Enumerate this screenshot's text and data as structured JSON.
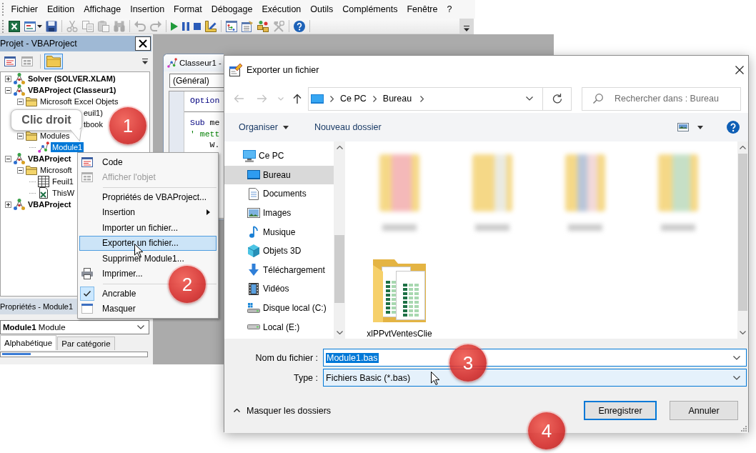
{
  "menu_bar": [
    "Fichier",
    "Edition",
    "Affichage",
    "Insertion",
    "Format",
    "Débogage",
    "Exécution",
    "Outils",
    "Compléments",
    "Fenêtre",
    "?"
  ],
  "toolbar": [
    {
      "kind": "button",
      "disabled": false
    },
    {
      "kind": "button",
      "disabled": false
    },
    {
      "kind": "button",
      "disabled": false
    },
    {
      "kind": "separator"
    },
    {
      "kind": "button",
      "disabled": true
    },
    {
      "kind": "button",
      "disabled": true
    },
    {
      "kind": "button",
      "disabled": true
    },
    {
      "kind": "button",
      "disabled": true
    },
    {
      "kind": "separator"
    },
    {
      "kind": "button",
      "disabled": true
    },
    {
      "kind": "button",
      "disabled": true
    },
    {
      "kind": "separator"
    },
    {
      "kind": "button",
      "disabled": false
    },
    {
      "kind": "button",
      "disabled": false
    },
    {
      "kind": "button",
      "disabled": false
    },
    {
      "kind": "button",
      "disabled": false
    },
    {
      "kind": "separator"
    },
    {
      "kind": "button",
      "disabled": false
    },
    {
      "kind": "button",
      "disabled": false
    },
    {
      "kind": "button",
      "disabled": false
    },
    {
      "kind": "button",
      "disabled": true
    },
    {
      "kind": "separator"
    },
    {
      "kind": "button",
      "disabled": false
    },
    {
      "kind": "separator"
    }
  ],
  "project_pane": {
    "title": "Projet - VBAProject",
    "toolbar": [
      {
        "disabled": false,
        "pressed": false
      },
      {
        "disabled": true,
        "pressed": false
      },
      {
        "disabled": false,
        "pressed": true
      }
    ],
    "tree": [
      {
        "kind": "project",
        "label": "Solver (SOLVER.XLAM)",
        "expanded": false,
        "selected": false
      },
      {
        "kind": "project",
        "label": "VBAProject (Classeur1)",
        "expanded": true,
        "selected": false,
        "children": [
          {
            "kind": "folder",
            "label": "Microsoft Excel Objets",
            "expanded": true,
            "selected": false,
            "children": [
              {
                "kind": "covered",
                "label": "euil1)",
                "selected": false
              },
              {
                "kind": "covered",
                "label": "tbook",
                "selected": false
              }
            ]
          },
          {
            "kind": "folder",
            "label": "Modules",
            "expanded": true,
            "selected": false,
            "children": [
              {
                "kind": "module",
                "label": "Module1",
                "selected": true
              }
            ]
          }
        ]
      },
      {
        "kind": "project",
        "label": "VBAProject",
        "expanded": true,
        "selected": false,
        "children": [
          {
            "kind": "folder",
            "label": "Microsoft",
            "expanded": true,
            "selected": false,
            "children": [
              {
                "kind": "sheet",
                "label": "Feuil1",
                "selected": false
              },
              {
                "kind": "workbook",
                "label": "ThisW",
                "selected": false
              }
            ]
          }
        ]
      },
      {
        "kind": "project",
        "label": "VBAProject",
        "expanded": false,
        "selected": false
      }
    ]
  },
  "properties_pane": {
    "title": "Propriétés - Module1",
    "object": "**Module1** Module",
    "tabs": [
      {
        "label": "Alphabétique",
        "selected": true
      },
      {
        "label": "Par catégorie",
        "selected": false
      }
    ]
  },
  "code_window": {
    "title": "Classeur1 -",
    "object": "(Général)",
    "lines": [
      {
        "kind": "code",
        "tokens": [
          {
            "kind": "keyword",
            "text": "Option"
          }
        ]
      },
      {
        "kind": "divider"
      },
      {
        "kind": "code",
        "tokens": [
          {
            "kind": "keyword",
            "text": "Sub"
          },
          {
            "kind": "plain",
            "text": " me"
          }
        ]
      },
      {
        "kind": "code",
        "tokens": [
          {
            "kind": "comment",
            "text": "' mett"
          }
        ]
      },
      {
        "kind": "code",
        "tokens": [
          {
            "kind": "plain",
            "text": "    W."
          }
        ]
      }
    ]
  },
  "context_menu": [
    {
      "kind": "item",
      "label": "Code",
      "disabled": false,
      "selected": false,
      "checked": false,
      "submenu": false
    },
    {
      "kind": "item",
      "label": "Afficher l'objet",
      "disabled": true,
      "selected": false,
      "checked": false,
      "submenu": false
    },
    {
      "kind": "separator"
    },
    {
      "kind": "item",
      "label": "Propriétés de VBAProject...",
      "disabled": false,
      "selected": false,
      "checked": false,
      "submenu": false
    },
    {
      "kind": "item",
      "label": "Insertion",
      "disabled": false,
      "selected": false,
      "checked": false,
      "submenu": true
    },
    {
      "kind": "item",
      "label": "Importer un fichier...",
      "disabled": false,
      "selected": false,
      "checked": false,
      "submenu": false
    },
    {
      "kind": "item",
      "label": "Exporter un fichier...",
      "disabled": false,
      "selected": true,
      "checked": false,
      "submenu": false
    },
    {
      "kind": "item",
      "label": "Supprimer Module1...",
      "disabled": false,
      "selected": false,
      "checked": false,
      "submenu": false
    },
    {
      "kind": "item",
      "label": "Imprimer...",
      "disabled": false,
      "selected": false,
      "checked": false,
      "submenu": false
    },
    {
      "kind": "separator"
    },
    {
      "kind": "item",
      "label": "Ancrable",
      "disabled": false,
      "selected": false,
      "checked": true,
      "submenu": false
    },
    {
      "kind": "item",
      "label": "Masquer",
      "disabled": false,
      "selected": false,
      "checked": false,
      "submenu": false
    }
  ],
  "dialog": {
    "title": "Exporter un fichier",
    "nav_buttons": [
      {
        "disabled": true
      },
      {
        "disabled": true
      },
      {
        "disabled": true
      },
      {
        "disabled": false
      }
    ],
    "address": [
      "Ce PC",
      "Bureau"
    ],
    "search": {
      "placeholder": "Rechercher dans : Bureau"
    },
    "commands": [
      {
        "label": "Organiser",
        "dropdown": true
      },
      {
        "label": "Nouveau dossier",
        "dropdown": false
      }
    ],
    "nav_pane": [
      {
        "label": "Ce PC",
        "selected": false,
        "children": [
          {
            "label": "Bureau",
            "selected": true
          },
          {
            "label": "Documents",
            "selected": false
          },
          {
            "label": "Images",
            "selected": false
          },
          {
            "label": "Musique",
            "selected": false
          },
          {
            "label": "Objets 3D",
            "selected": false
          },
          {
            "label": "Téléchargement",
            "selected": false
          },
          {
            "label": "Vidéos",
            "selected": false
          },
          {
            "label": "Disque local (C:)",
            "selected": false
          },
          {
            "label": "Local (E:)",
            "selected": false
          }
        ]
      }
    ],
    "files": [
      {
        "kind": "blurred",
        "selected": false
      },
      {
        "kind": "blurred",
        "selected": false
      },
      {
        "kind": "blurred",
        "selected": false
      },
      {
        "kind": "blurred",
        "selected": false
      },
      {
        "kind": "folder",
        "label": "xlPPvtVentesClie",
        "selected": false
      }
    ],
    "fields": [
      {
        "label": "Nom du fichier :",
        "value": "Module1.bas",
        "focused": true,
        "hovered": false,
        "text_selected": true
      },
      {
        "label": "Type :",
        "value": "Fichiers Basic (*.bas)",
        "focused": false,
        "hovered": true,
        "text_selected": false
      }
    ],
    "hide_folders": "Masquer les dossiers",
    "buttons": [
      {
        "label": "Enregistrer",
        "default": true
      },
      {
        "label": "Annuler",
        "default": false
      }
    ]
  },
  "annotations": {
    "callout": "Clic droit",
    "steps": [
      "1",
      "2",
      "3",
      "4"
    ]
  }
}
